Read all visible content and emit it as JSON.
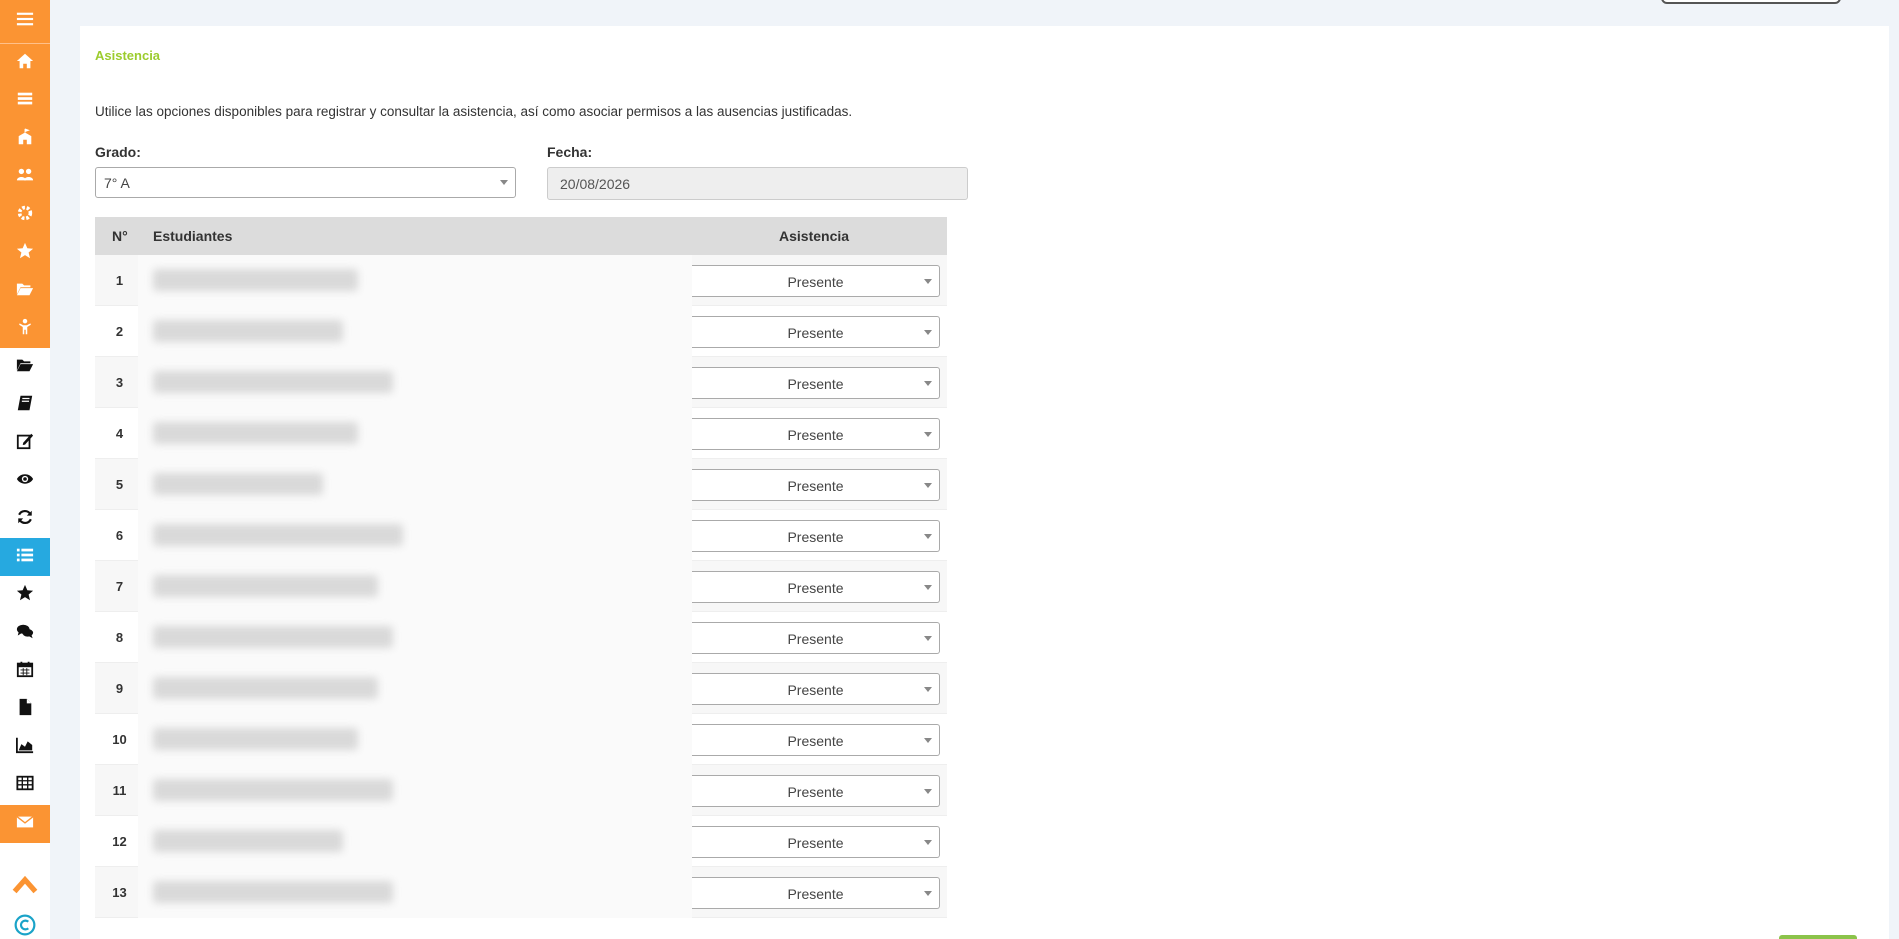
{
  "sidebar": {
    "icons": [
      {
        "icon": "menu-icon",
        "style": "orange"
      },
      {
        "icon": "home-icon",
        "style": "orange"
      },
      {
        "icon": "list-icon",
        "style": "orange"
      },
      {
        "icon": "school-icon",
        "style": "orange"
      },
      {
        "icon": "users-icon",
        "style": "orange"
      },
      {
        "icon": "gear-icon",
        "style": "orange"
      },
      {
        "icon": "star-icon",
        "style": "orange"
      },
      {
        "icon": "folder-open-icon",
        "style": "orange"
      },
      {
        "icon": "child-icon",
        "style": "orange"
      },
      {
        "icon": "folder-icon",
        "style": "white"
      },
      {
        "icon": "book-icon",
        "style": "white"
      },
      {
        "icon": "edit-icon",
        "style": "white"
      },
      {
        "icon": "eye-icon",
        "style": "white"
      },
      {
        "icon": "refresh-icon",
        "style": "white"
      },
      {
        "icon": "list-ul-icon",
        "style": "active"
      },
      {
        "icon": "star-icon",
        "style": "white"
      },
      {
        "icon": "chat-icon",
        "style": "white"
      },
      {
        "icon": "calendar-icon",
        "style": "white"
      },
      {
        "icon": "file-icon",
        "style": "white"
      },
      {
        "icon": "area-chart-icon",
        "style": "white"
      },
      {
        "icon": "table-icon",
        "style": "white"
      },
      {
        "icon": "mail-icon",
        "style": "orange"
      }
    ],
    "scroll_top_icon": "chevron-up-icon",
    "copyright_icon": "copyright-icon"
  },
  "page": {
    "title": "Asistencia",
    "description": "Utilice las opciones disponibles para registrar y consultar la asistencia, así como asociar permisos a las ausencias justificadas.",
    "grado_label": "Grado:",
    "grado_value": "7° A",
    "fecha_label": "Fecha:",
    "fecha_value": "20/08/2026"
  },
  "table": {
    "headers": {
      "num": "N°",
      "students": "Estudiantes",
      "attendance": "Asistencia"
    },
    "rows": [
      {
        "num": "1",
        "attendance": "Presente"
      },
      {
        "num": "2",
        "attendance": "Presente"
      },
      {
        "num": "3",
        "attendance": "Presente"
      },
      {
        "num": "4",
        "attendance": "Presente"
      },
      {
        "num": "5",
        "attendance": "Presente"
      },
      {
        "num": "6",
        "attendance": "Presente"
      },
      {
        "num": "7",
        "attendance": "Presente"
      },
      {
        "num": "8",
        "attendance": "Presente"
      },
      {
        "num": "9",
        "attendance": "Presente"
      },
      {
        "num": "10",
        "attendance": "Presente"
      },
      {
        "num": "11",
        "attendance": "Presente"
      },
      {
        "num": "12",
        "attendance": "Presente"
      },
      {
        "num": "13",
        "attendance": "Presente"
      }
    ]
  },
  "colors": {
    "sidebar_orange": "#fb9433",
    "sidebar_active": "#26a9e0",
    "title_green": "#9ccc2e"
  }
}
